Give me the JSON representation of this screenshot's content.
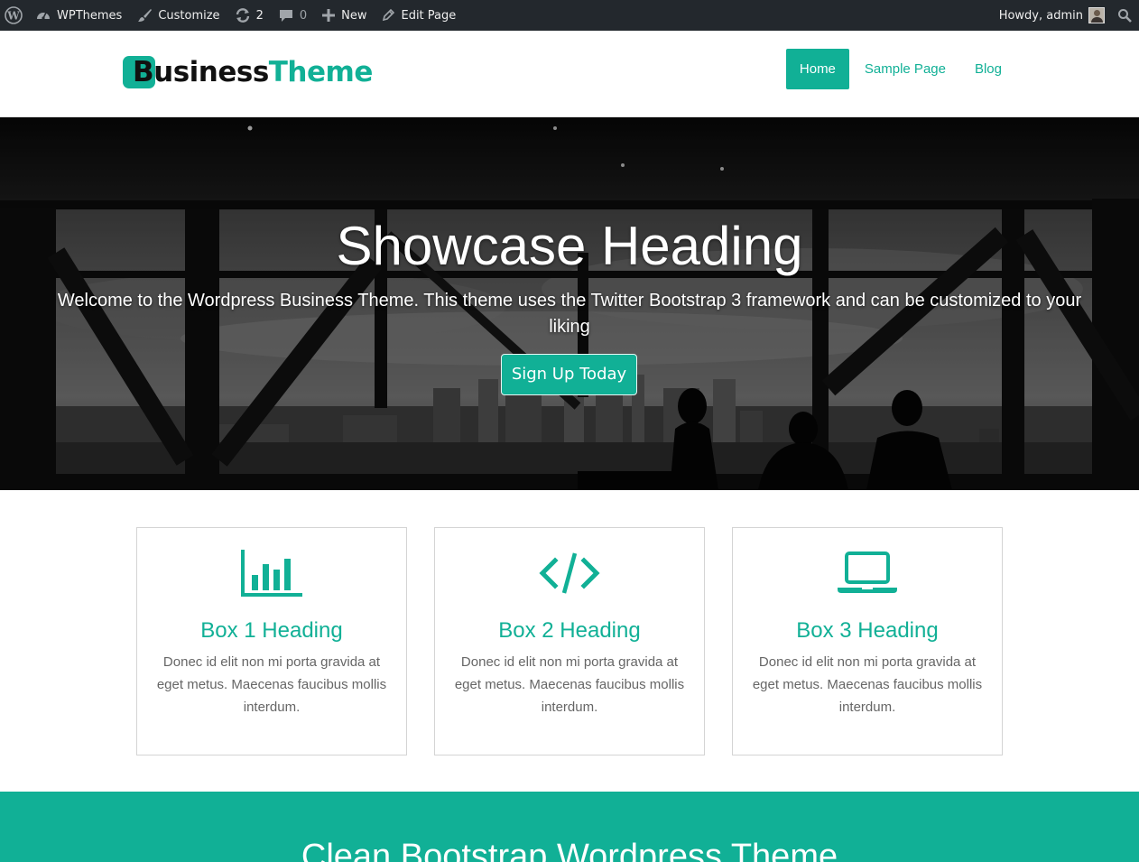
{
  "admin_bar": {
    "site_name": "WPThemes",
    "customize": "Customize",
    "updates_count": "2",
    "comments_count": "0",
    "new_label": "New",
    "edit_page": "Edit Page",
    "howdy": "Howdy, admin"
  },
  "header": {
    "logo_part1": "Business",
    "logo_part2": "Theme",
    "nav": [
      {
        "label": "Home",
        "active": true
      },
      {
        "label": "Sample Page",
        "active": false
      },
      {
        "label": "Blog",
        "active": false
      }
    ]
  },
  "showcase": {
    "heading": "Showcase Heading",
    "text": "Welcome to the Wordpress Business Theme. This theme uses the Twitter Bootstrap 3 framework and can be customized to your liking",
    "button": "Sign Up Today"
  },
  "boxes": [
    {
      "icon": "bar-chart-icon",
      "heading": "Box 1 Heading",
      "text": "Donec id elit non mi porta gravida at eget metus. Maecenas faucibus mollis interdum."
    },
    {
      "icon": "code-icon",
      "heading": "Box 2 Heading",
      "text": "Donec id elit non mi porta gravida at eget metus. Maecenas faucibus mollis interdum."
    },
    {
      "icon": "laptop-icon",
      "heading": "Box 3 Heading",
      "text": "Donec id elit non mi porta gravida at eget metus. Maecenas faucibus mollis interdum."
    }
  ],
  "band": {
    "heading": "Clean Bootstrap Wordpress Theme"
  },
  "colors": {
    "accent": "#11b096",
    "admin_bar_bg": "#23282d",
    "body_text": "#666666"
  }
}
